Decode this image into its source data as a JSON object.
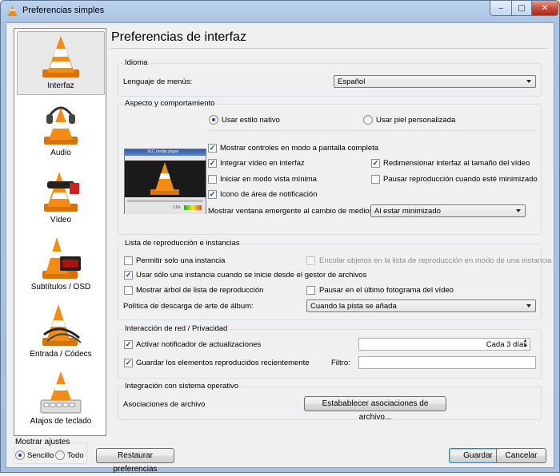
{
  "window": {
    "title": "Preferencias simples",
    "minimize_icon": "minimize-icon",
    "maximize_icon": "maximize-icon",
    "close_icon": "close-icon"
  },
  "sidebar": {
    "items": [
      {
        "label": "Interfaz",
        "icon": "interface-cone-icon",
        "selected": true
      },
      {
        "label": "Audio",
        "icon": "headphones-cone-icon"
      },
      {
        "label": "Vídeo",
        "icon": "glasses-cone-icon"
      },
      {
        "label": "Subtítulos / OSD",
        "icon": "clock-cone-icon"
      },
      {
        "label": "Entrada / Códecs",
        "icon": "cables-cone-icon"
      },
      {
        "label": "Atajos de teclado",
        "icon": "keyboard-cone-icon"
      }
    ]
  },
  "show_settings": {
    "title": "Mostrar ajustes",
    "simple_label": "Sencillo",
    "all_label": "Todo",
    "selected": "Sencillo"
  },
  "header": {
    "title": "Preferencias de interfaz"
  },
  "language": {
    "group_title": "Idioma",
    "label": "Lenguaje de menús:",
    "value": "Español"
  },
  "appearance": {
    "group_title": "Aspecto y comportamiento",
    "native_style": "Usar estilo nativo",
    "custom_skin": "Usar piel personalizada",
    "fullscreen_controls": "Mostrar controles en modo a pantalla completa",
    "integrate_video": "Integrar vídeo en interfaz",
    "resize_interface": "Redimensionar interfaz al tamaño del vídeo",
    "minimal_view": "Iniciar en modo vista mínima",
    "pause_minimized": "Pausar reproducción cuando esté minimizado",
    "systray_icon": "Icono de área de notificación",
    "popup_label": "Mostrar ventana emergente al cambio de medios:",
    "popup_value": "Al estar minimizado",
    "preview_title": "VLC media player",
    "preview_time": "1.6x"
  },
  "playlist": {
    "group_title": "Lista de reproducción e instancias",
    "single_instance": "Permitir solo una instancia",
    "enqueue_single": "Encolar objetos en la lista de reproducción en modo de una instancia",
    "one_instance_fm": "Usar sólo una instancia cuando se inicie desde el gestor de archivos",
    "show_tree": "Mostrar árbol de lista de reproducción",
    "pause_last_frame": "Pausar en el último fotograma del vídeo",
    "art_policy_label": "Política de descarga de arte de álbum:",
    "art_policy_value": "Cuando la pista se añada"
  },
  "network": {
    "group_title": "Interacción de red / Privacidad",
    "update_notifier": "Activar notificador de actualizaciones",
    "update_interval": "Cada 3 días",
    "save_recent": "Guardar los elementos reproducidos recientemente",
    "filter_label": "Filtro:",
    "filter_value": ""
  },
  "os_integration": {
    "group_title": "Integración con sistema operativo",
    "file_assoc_label": "Asociaciones de archivo",
    "file_assoc_button": "Estabablecer asociaciones de archivo..."
  },
  "footer": {
    "reset": "Restaurar preferencias",
    "save": "Guardar",
    "cancel": "Cancelar"
  },
  "colors": {
    "cone_orange": "#f28c14",
    "selection_bg": "#e8e8e8",
    "title_bar": "#bcd3ec"
  }
}
